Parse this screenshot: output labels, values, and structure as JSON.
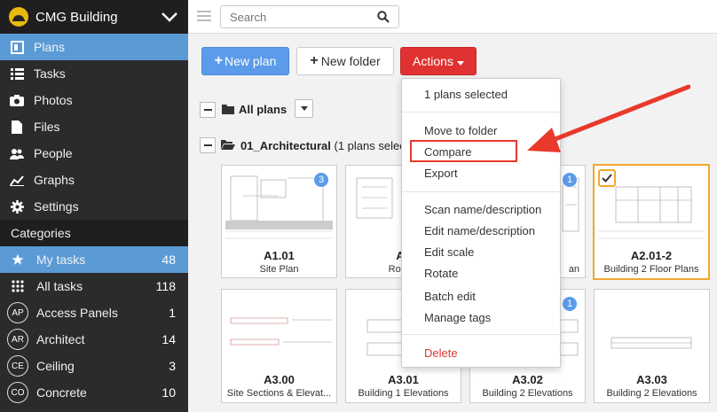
{
  "sidebar": {
    "project_name": "CMG Building",
    "nav": [
      {
        "label": "Plans",
        "icon": "plans-icon",
        "active": true
      },
      {
        "label": "Tasks",
        "icon": "tasks-icon"
      },
      {
        "label": "Photos",
        "icon": "camera-icon"
      },
      {
        "label": "Files",
        "icon": "file-icon"
      },
      {
        "label": "People",
        "icon": "people-icon"
      },
      {
        "label": "Graphs",
        "icon": "graph-icon"
      },
      {
        "label": "Settings",
        "icon": "gear-icon"
      }
    ],
    "categories_header": "Categories",
    "categories": [
      {
        "label": "My tasks",
        "count": "48",
        "icon": "star-icon",
        "active": true
      },
      {
        "label": "All tasks",
        "count": "118",
        "icon": "grid-icon"
      },
      {
        "label": "Access Panels",
        "count": "1",
        "badge": "AP"
      },
      {
        "label": "Architect",
        "count": "14",
        "badge": "AR"
      },
      {
        "label": "Ceiling",
        "count": "3",
        "badge": "CE"
      },
      {
        "label": "Concrete",
        "count": "10",
        "badge": "CO"
      }
    ]
  },
  "topbar": {
    "search_placeholder": "Search"
  },
  "toolbar": {
    "new_plan": "New plan",
    "new_folder": "New folder",
    "actions": "Actions"
  },
  "tree": {
    "all_plans": "All plans",
    "folder_name": "01_Architectural",
    "folder_note": "(1 plans select"
  },
  "cards": [
    {
      "title": "A1.01",
      "subtitle": "Site Plan",
      "badge": "3"
    },
    {
      "title": "A1",
      "subtitle": "Roof S"
    },
    {
      "title": "",
      "subtitle": "an",
      "badge": "1"
    },
    {
      "title": "A2.01-2",
      "subtitle": "Building 2 Floor Plans",
      "checked": true
    },
    {
      "title": "A3.00",
      "subtitle": "Site Sections & Elevat..."
    },
    {
      "title": "A3.01",
      "subtitle": "Building 1 Elevations"
    },
    {
      "title": "A3.02",
      "subtitle": "Building 2 Elevations",
      "badge": "1"
    },
    {
      "title": "A3.03",
      "subtitle": "Building 2 Elevations"
    }
  ],
  "menu": {
    "selected_count": "1 plans selected",
    "items_group1": [
      "Move to folder",
      "Compare",
      "Export"
    ],
    "items_group2": [
      "Scan name/description",
      "Edit name/description",
      "Edit scale",
      "Rotate",
      "Batch edit",
      "Manage tags"
    ],
    "delete": "Delete"
  },
  "colors": {
    "sidebar_bg": "#2b2b2b",
    "active_blue": "#5b9bd5",
    "primary_button": "#5b9bea",
    "actions_red": "#e03232",
    "annotation_red": "#e8392b",
    "selected_orange": "#f0a830"
  }
}
